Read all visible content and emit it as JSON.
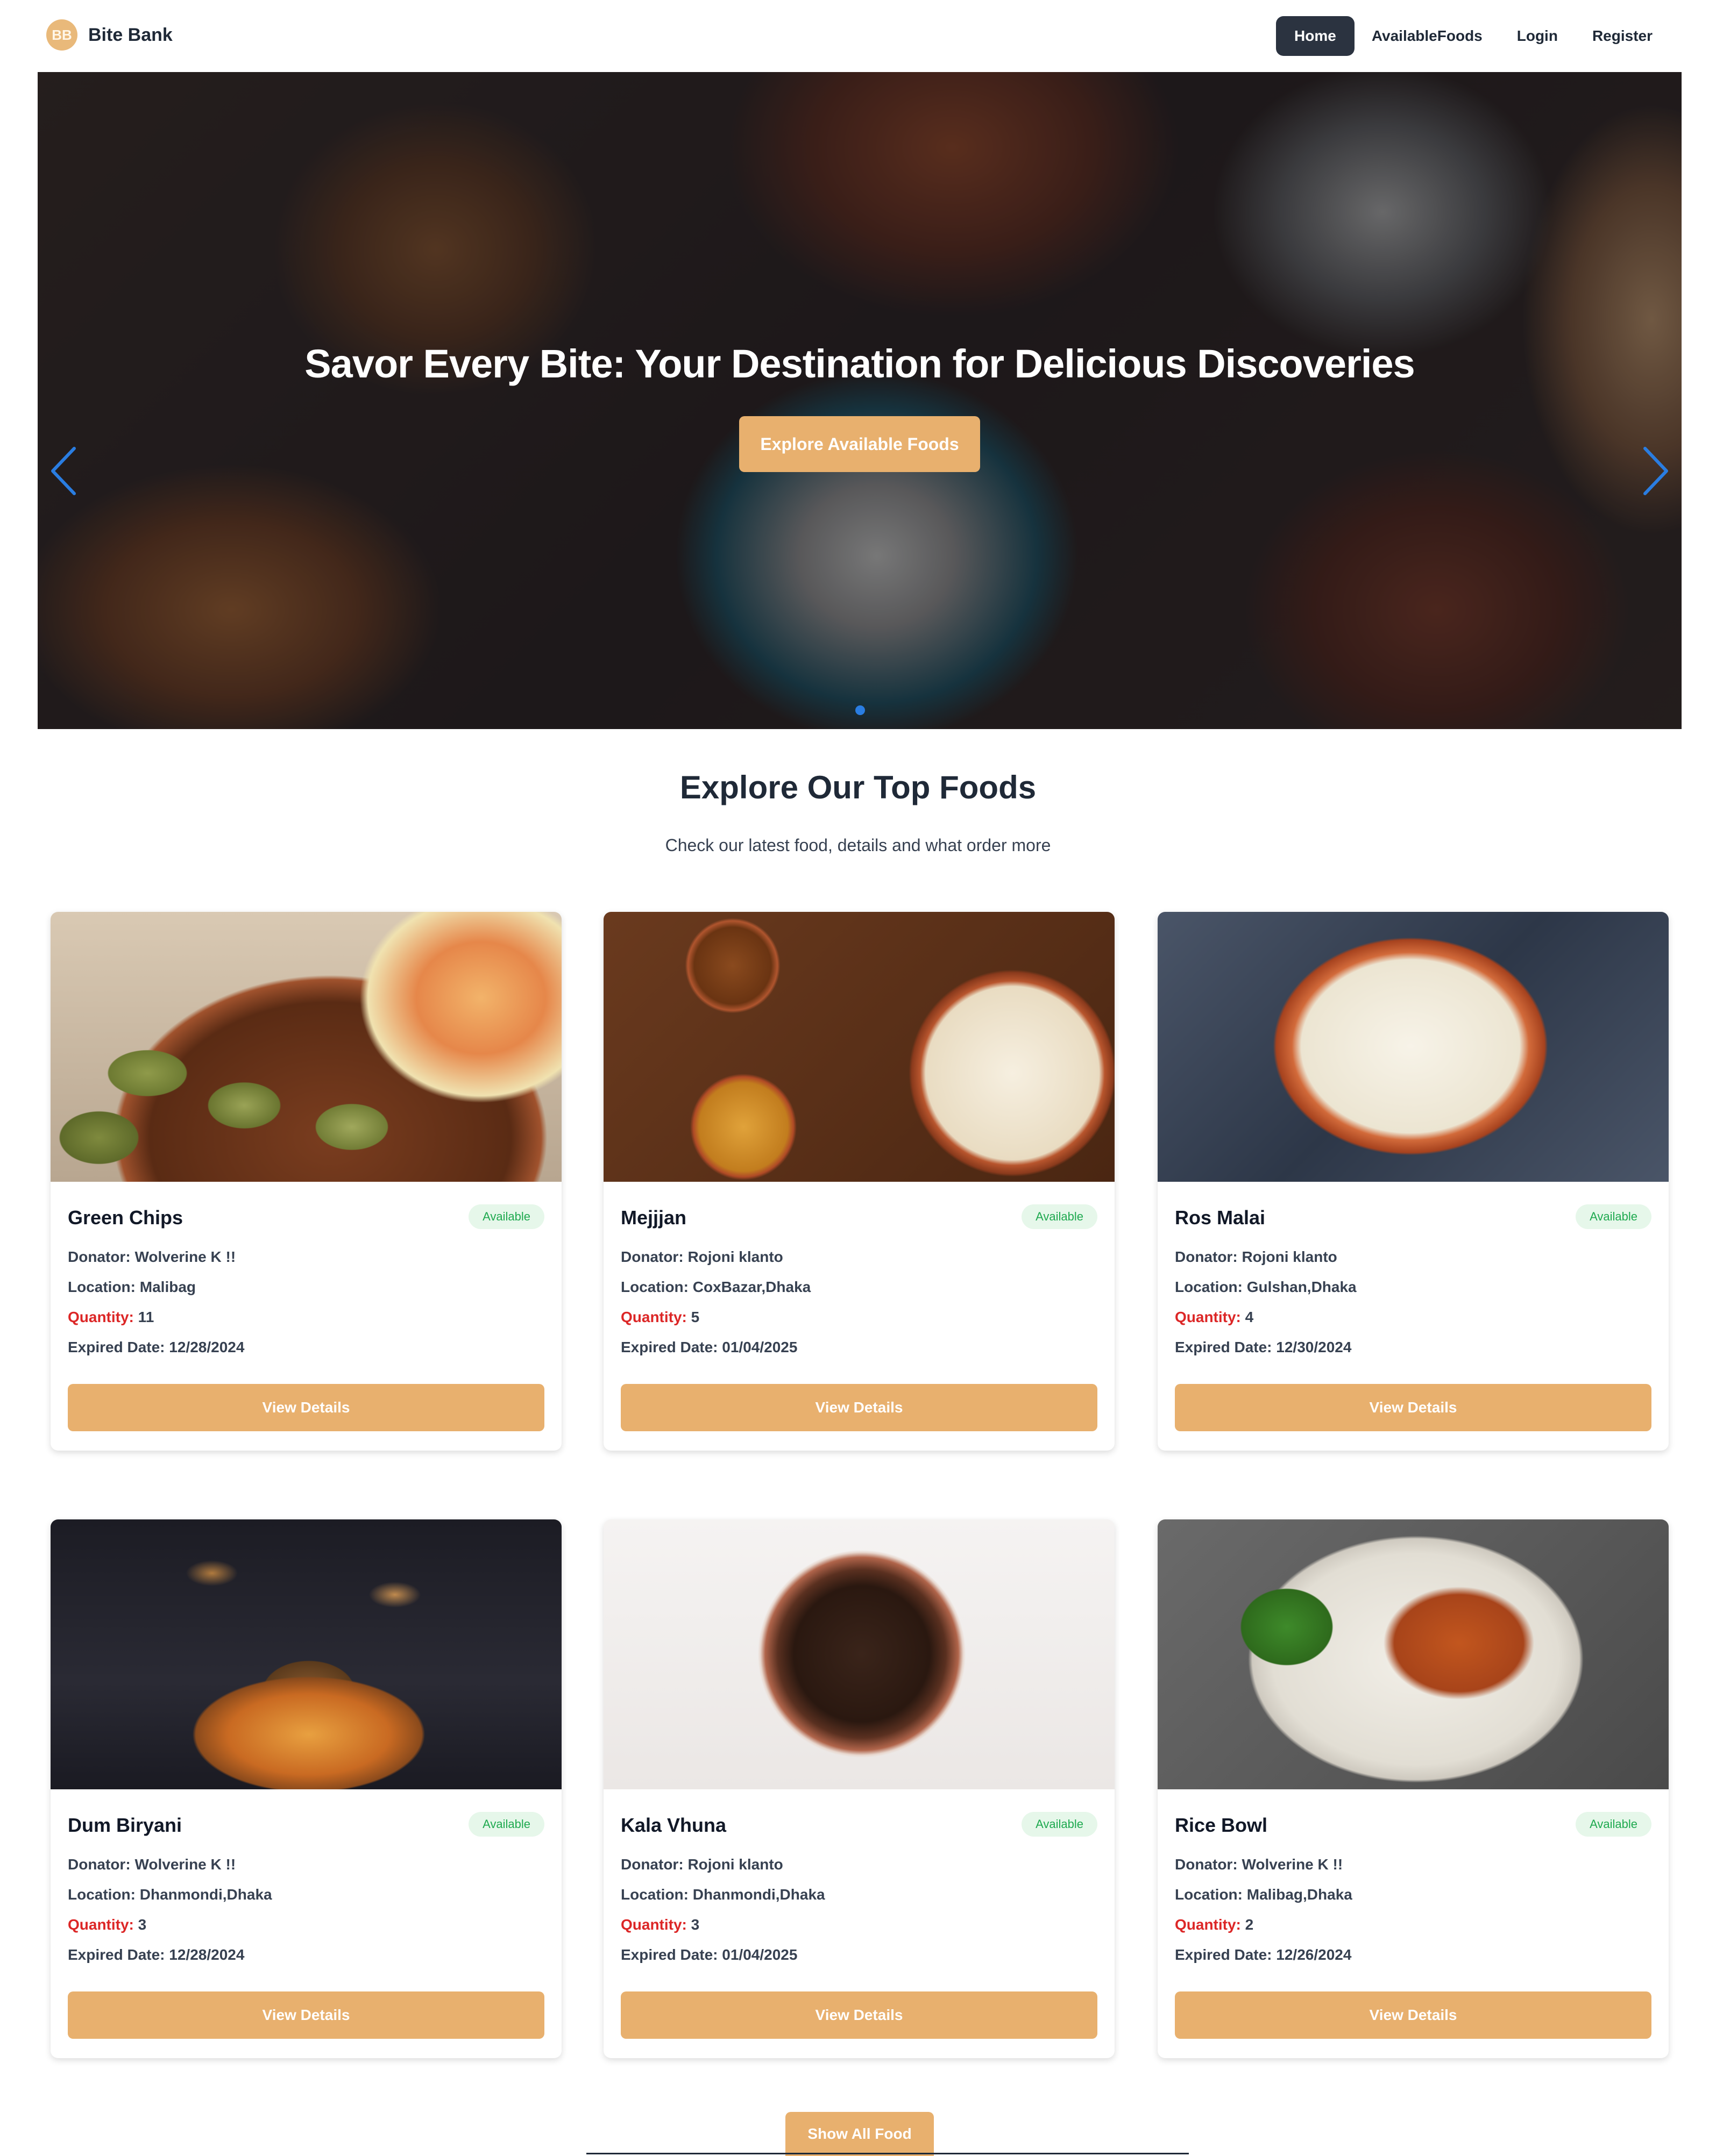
{
  "brand": {
    "logo_text": "BB",
    "name": "Bite Bank"
  },
  "nav": {
    "items": [
      {
        "label": "Home",
        "active": true
      },
      {
        "label": "AvailableFoods",
        "active": false
      },
      {
        "label": "Login",
        "active": false
      },
      {
        "label": "Register",
        "active": false
      }
    ]
  },
  "hero": {
    "title": "Savor Every Bite: Your Destination for Delicious Discoveries",
    "cta_label": "Explore Available Foods",
    "prev_icon": "chevron-left-icon",
    "next_icon": "chevron-right-icon"
  },
  "section": {
    "title": "Explore Our Top Foods",
    "subtitle": "Check our latest food, details and what order more"
  },
  "labels": {
    "donator": "Donator:",
    "location": "Location:",
    "quantity": "Quantity:",
    "expired": "Expired Date:",
    "view_details": "View Details"
  },
  "foods": [
    {
      "name": "Green Chips",
      "status": "Available",
      "donator": "Wolverine K !!",
      "location": "Malibag",
      "quantity": "11",
      "expired": "12/28/2024"
    },
    {
      "name": "Mejjjan",
      "status": "Available",
      "donator": "Rojoni klanto",
      "location": "CoxBazar,Dhaka",
      "quantity": "5",
      "expired": "01/04/2025"
    },
    {
      "name": "Ros Malai",
      "status": "Available",
      "donator": "Rojoni klanto",
      "location": "Gulshan,Dhaka",
      "quantity": "4",
      "expired": "12/30/2024"
    },
    {
      "name": "Dum Biryani",
      "status": "Available",
      "donator": "Wolverine K !!",
      "location": "Dhanmondi,Dhaka",
      "quantity": "3",
      "expired": "12/28/2024"
    },
    {
      "name": "Kala Vhuna",
      "status": "Available",
      "donator": "Rojoni klanto",
      "location": "Dhanmondi,Dhaka",
      "quantity": "3",
      "expired": "01/04/2025"
    },
    {
      "name": "Rice Bowl",
      "status": "Available",
      "donator": "Wolverine K !!",
      "location": "Malibag,Dhaka",
      "quantity": "2",
      "expired": "12/26/2024"
    }
  ],
  "show_all_label": "Show All Food",
  "colors": {
    "accent": "#e8b06e",
    "nav_active": "#2b3340",
    "badge_text": "#1ea94f",
    "badge_bg": "#e6f7ea",
    "quantity_label": "#dc2626",
    "carousel_arrow": "#2a7de1"
  }
}
